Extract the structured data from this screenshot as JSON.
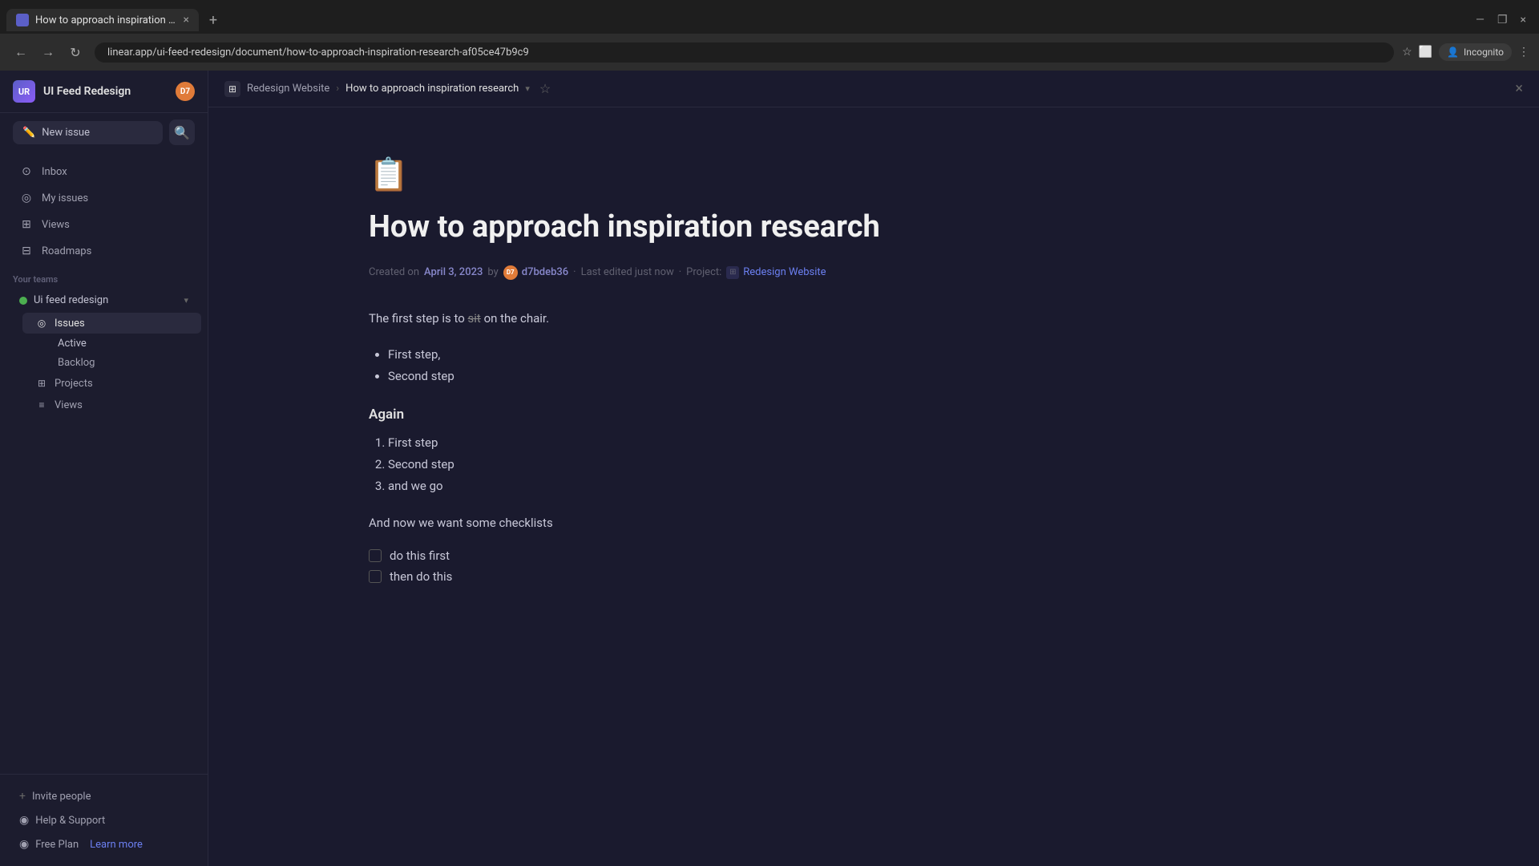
{
  "browser": {
    "tab_title": "How to approach inspiration res...",
    "tab_close": "×",
    "tab_new": "+",
    "url": "linear.app/ui-feed-redesign/document/how-to-approach-inspiration-research-af05ce47b9c9",
    "nav_back": "←",
    "nav_forward": "→",
    "nav_reload": "↻",
    "window_controls": {
      "minimize": "—",
      "maximize": "❐",
      "close": "×"
    },
    "incognito_label": "Incognito",
    "more_label": "⋮",
    "star_icon": "☆",
    "extensions_icon": "⬜"
  },
  "sidebar": {
    "workspace_initials": "UR",
    "workspace_name": "UI Feed Redesign",
    "user_initials": "D7",
    "new_issue_label": "New issue",
    "search_icon": "🔍",
    "nav_items": [
      {
        "id": "inbox",
        "label": "Inbox",
        "icon": "⊙"
      },
      {
        "id": "my-issues",
        "label": "My issues",
        "icon": "◎"
      },
      {
        "id": "views",
        "label": "Views",
        "icon": "⊞"
      },
      {
        "id": "roadmaps",
        "label": "Roadmaps",
        "icon": "⊟"
      }
    ],
    "your_teams_label": "Your teams",
    "team_name": "Ui feed redesign",
    "team_chevron": "▾",
    "team_sub_items": [
      {
        "id": "issues",
        "label": "Issues",
        "icon": "◎"
      },
      {
        "id": "projects",
        "label": "Projects",
        "icon": "⊞"
      },
      {
        "id": "views",
        "label": "Views",
        "icon": "≡"
      }
    ],
    "issues_sub": [
      {
        "id": "active",
        "label": "Active"
      },
      {
        "id": "backlog",
        "label": "Backlog"
      }
    ],
    "invite_label": "Invite people",
    "invite_icon": "+",
    "help_label": "Help & Support",
    "help_icon": "?",
    "free_plan_label": "Free Plan",
    "free_plan_icon": "◉",
    "learn_more_label": "Learn more"
  },
  "document": {
    "header_icon": "⊞",
    "breadcrumb_parent": "Redesign Website",
    "breadcrumb_separator": "›",
    "breadcrumb_current": "How to approach inspiration research",
    "breadcrumb_chevron": "▾",
    "star_icon": "☆",
    "close_icon": "×",
    "doc_emoji": "📋",
    "title": "How to approach inspiration research",
    "meta": {
      "created_label": "Created on",
      "created_date": "April 3, 2023",
      "by_label": "by",
      "author_initials": "D7",
      "author_handle": "d7bdeb36",
      "separator1": "·",
      "last_edited": "Last edited just now",
      "separator2": "·",
      "project_label": "Project:",
      "project_icon": "⊞",
      "project_name": "Redesign Website"
    },
    "content": {
      "intro_paragraph": "The first step is to sit on the chair.",
      "intro_strikethrough": "sit",
      "bullet_items": [
        "First step,",
        "Second step"
      ],
      "heading2": "Again",
      "ordered_items": [
        "First step",
        "Second step",
        "and we go"
      ],
      "checklist_heading": "And now we want some checklists",
      "checklist_items": [
        {
          "text": "do this first",
          "checked": false
        },
        {
          "text": "then do this",
          "checked": false
        }
      ]
    }
  }
}
